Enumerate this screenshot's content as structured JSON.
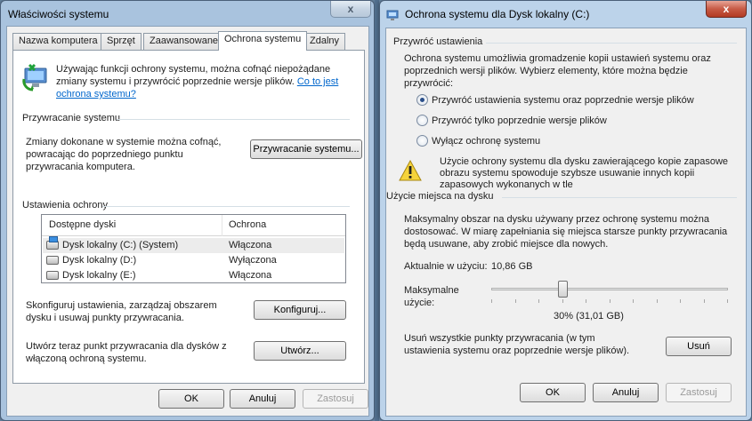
{
  "left_window": {
    "title": "Właściwości systemu",
    "close_glyph": "x",
    "tabs": [
      {
        "label": "Nazwa komputera"
      },
      {
        "label": "Sprzęt"
      },
      {
        "label": "Zaawansowane"
      },
      {
        "label": "Ochrona systemu"
      },
      {
        "label": "Zdalny"
      }
    ],
    "intro_text": "Używając funkcji ochrony systemu, można cofnąć niepożądane zmiany systemu i przywrócić poprzednie wersje plików.",
    "intro_link": "Co to jest ochrona systemu?",
    "restore_section": {
      "heading": "Przywracanie systemu",
      "text": "Zmiany dokonane w systemie można cofnąć, powracając do poprzedniego punktu przywracania komputera.",
      "button": "Przywracanie systemu..."
    },
    "protection_section": {
      "heading": "Ustawienia ochrony",
      "columns": [
        "Dostępne dyski",
        "Ochrona"
      ],
      "rows": [
        {
          "drive": "Dysk lokalny (C:) (System)",
          "status": "Włączona"
        },
        {
          "drive": "Dysk lokalny (D:)",
          "status": "Wyłączona"
        },
        {
          "drive": "Dysk lokalny (E:)",
          "status": "Włączona"
        }
      ],
      "configure_text": "Skonfiguruj ustawienia, zarządzaj obszarem dysku i usuwaj punkty przywracania.",
      "configure_button": "Konfiguruj...",
      "create_text": "Utwórz teraz punkt przywracania dla dysków z włączoną ochroną systemu.",
      "create_button": "Utwórz..."
    },
    "footer": {
      "ok": "OK",
      "cancel": "Anuluj",
      "apply": "Zastosuj"
    }
  },
  "right_window": {
    "title": "Ochrona systemu dla Dysk lokalny (C:)",
    "close_glyph": "x",
    "restore_settings": {
      "heading": "Przywróć ustawienia",
      "text": "Ochrona systemu umożliwia gromadzenie kopii ustawień systemu oraz poprzednich wersji plików. Wybierz elementy, które można będzie przywrócić:",
      "options": [
        {
          "label": "Przywróć ustawienia systemu oraz poprzednie wersje plików",
          "selected": true
        },
        {
          "label": "Przywróć tylko poprzednie wersje plików",
          "selected": false
        },
        {
          "label": "Wyłącz ochronę systemu",
          "selected": false
        }
      ],
      "warning": "Użycie ochrony systemu dla dysku zawierającego kopie zapasowe obrazu systemu spowoduje szybsze usuwanie innych kopii zapasowych wykonanych w tle"
    },
    "disk_usage": {
      "heading": "Użycie miejsca na dysku",
      "text": "Maksymalny obszar na dysku używany przez ochronę systemu można dostosować. W miarę zapełniania się miejsca starsze punkty przywracania będą usuwane, aby zrobić miejsce dla nowych.",
      "current_label": "Aktualnie w użyciu:",
      "current_value": "10,86 GB",
      "max_label": "Maksymalne użycie:",
      "slider_percent": 30,
      "slider_value_text": "30% (31,01 GB)",
      "delete_text": "Usuń wszystkie punkty przywracania (w tym ustawienia systemu oraz poprzednie wersje plików).",
      "delete_button": "Usuń"
    },
    "footer": {
      "ok": "OK",
      "cancel": "Anuluj",
      "apply": "Zastosuj"
    }
  }
}
